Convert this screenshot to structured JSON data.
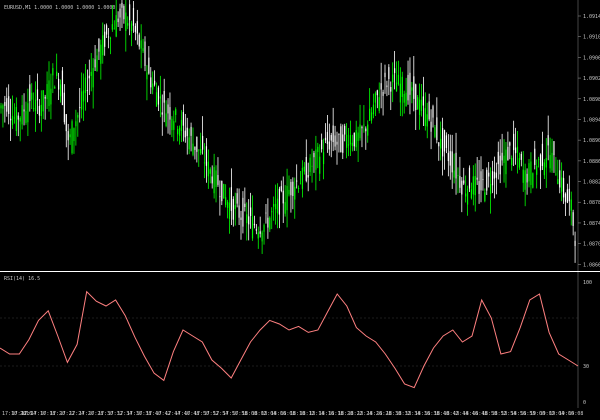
{
  "window": {
    "symbol_info": "EURUSD,M1 1.0000 1.0000 1.0000 1.0000",
    "indicator_info": "RSI(14) 16.5"
  },
  "colors": {
    "background": "#000000",
    "bull": "#00ff00",
    "bear": "#ffffff",
    "indicator_line": "#ff8080",
    "separator": "#ffffff",
    "level_line": "#3a3a3a"
  },
  "chart_data": [
    {
      "type": "candlestick",
      "ylim": [
        1.0866,
        1.0914
      ],
      "y_ticks": [
        "1.0914",
        "1.0910",
        "1.0906",
        "1.0902",
        "1.0898",
        "1.0894",
        "1.0890",
        "1.0886",
        "1.0882",
        "1.0878",
        "1.0874",
        "1.0870",
        "1.0866"
      ],
      "x_ticks": [
        "17:10 2016",
        "17:12",
        "17:14",
        "17:16",
        "17:18",
        "17:20",
        "17:22",
        "17:24",
        "17:26",
        "17:28",
        "17:30",
        "17:32",
        "17:34",
        "17:36",
        "17:38",
        "17:40",
        "17:42",
        "17:44",
        "17:46",
        "17:48",
        "17:50",
        "17:52",
        "17:54",
        "17:56",
        "17:58",
        "18:00",
        "18:02",
        "18:04",
        "18:06",
        "18:08",
        "18:10",
        "18:12",
        "18:14",
        "18:16",
        "18:18",
        "18:20",
        "18:22",
        "18:24",
        "18:26",
        "18:28",
        "18:30",
        "18:32",
        "18:34",
        "18:36",
        "18:38",
        "18:40",
        "18:42",
        "18:44",
        "18:46",
        "18:48",
        "18:50",
        "18:52",
        "18:54",
        "18:56",
        "18:58",
        "19:00",
        "19:02",
        "19:04",
        "19:06",
        "19:08"
      ],
      "close_path": [
        [
          0,
          1.0896
        ],
        [
          4,
          1.0897
        ],
        [
          8,
          1.0894
        ],
        [
          12,
          1.0895
        ],
        [
          16,
          1.0898
        ],
        [
          20,
          1.0896
        ],
        [
          24,
          1.0898
        ],
        [
          28,
          1.0902
        ],
        [
          32,
          1.0901
        ],
        [
          34,
          1.0895
        ],
        [
          36,
          1.0889
        ],
        [
          38,
          1.0892
        ],
        [
          42,
          1.0896
        ],
        [
          46,
          1.0901
        ],
        [
          50,
          1.0905
        ],
        [
          54,
          1.0908
        ],
        [
          58,
          1.0911
        ],
        [
          62,
          1.0913
        ],
        [
          66,
          1.0913
        ],
        [
          70,
          1.0911
        ],
        [
          74,
          1.0907
        ],
        [
          78,
          1.0902
        ],
        [
          82,
          1.0899
        ],
        [
          86,
          1.0896
        ],
        [
          90,
          1.0895
        ],
        [
          94,
          1.0893
        ],
        [
          98,
          1.0891
        ],
        [
          102,
          1.0889
        ],
        [
          106,
          1.0887
        ],
        [
          110,
          1.0884
        ],
        [
          114,
          1.0882
        ],
        [
          118,
          1.0879
        ],
        [
          122,
          1.0877
        ],
        [
          126,
          1.0876
        ],
        [
          130,
          1.0875
        ],
        [
          134,
          1.0874
        ],
        [
          138,
          1.0874
        ],
        [
          142,
          1.0876
        ],
        [
          146,
          1.0878
        ],
        [
          150,
          1.088
        ],
        [
          154,
          1.0882
        ],
        [
          158,
          1.0883
        ],
        [
          162,
          1.0885
        ],
        [
          166,
          1.0887
        ],
        [
          170,
          1.0889
        ],
        [
          174,
          1.089
        ],
        [
          178,
          1.0889
        ],
        [
          182,
          1.0891
        ],
        [
          186,
          1.089
        ],
        [
          190,
          1.0892
        ],
        [
          194,
          1.0895
        ],
        [
          198,
          1.0899
        ],
        [
          202,
          1.0901
        ],
        [
          206,
          1.0901
        ],
        [
          210,
          1.09
        ],
        [
          214,
          1.0899
        ],
        [
          218,
          1.0897
        ],
        [
          222,
          1.0895
        ],
        [
          226,
          1.0893
        ],
        [
          230,
          1.0889
        ],
        [
          234,
          1.0887
        ],
        [
          238,
          1.0884
        ],
        [
          242,
          1.0881
        ],
        [
          246,
          1.0882
        ],
        [
          250,
          1.0881
        ],
        [
          254,
          1.0882
        ],
        [
          258,
          1.0884
        ],
        [
          262,
          1.0886
        ],
        [
          266,
          1.0888
        ],
        [
          270,
          1.0887
        ],
        [
          274,
          1.0883
        ],
        [
          278,
          1.0885
        ],
        [
          282,
          1.0886
        ],
        [
          286,
          1.0888
        ],
        [
          290,
          1.0885
        ],
        [
          294,
          1.088
        ],
        [
          298,
          1.0877
        ],
        [
          300,
          1.0872
        ]
      ]
    },
    {
      "type": "line",
      "ylim": [
        0,
        100
      ],
      "levels": [
        30,
        70
      ],
      "y_ticks": [
        "100",
        "30",
        "0"
      ],
      "x": [
        0,
        5,
        10,
        15,
        20,
        25,
        30,
        35,
        40,
        45,
        50,
        55,
        60,
        65,
        70,
        75,
        80,
        85,
        90,
        95,
        100,
        105,
        110,
        115,
        120,
        125,
        130,
        135,
        140,
        145,
        150,
        155,
        160,
        165,
        170,
        175,
        180,
        185,
        190,
        195,
        200,
        205,
        210,
        215,
        220,
        225,
        230,
        235,
        240,
        245,
        250,
        255,
        260,
        265,
        270,
        275,
        280,
        285,
        290,
        295,
        300
      ],
      "values": [
        45,
        40,
        40,
        52,
        68,
        76,
        55,
        33,
        48,
        92,
        84,
        80,
        85,
        72,
        54,
        38,
        24,
        18,
        42,
        60,
        55,
        50,
        35,
        28,
        20,
        35,
        50,
        60,
        68,
        65,
        60,
        63,
        58,
        60,
        75,
        90,
        80,
        62,
        55,
        50,
        40,
        28,
        15,
        12,
        30,
        45,
        55,
        60,
        50,
        55,
        85,
        70,
        40,
        42,
        62,
        85,
        90,
        58,
        40,
        35,
        30
      ]
    }
  ]
}
